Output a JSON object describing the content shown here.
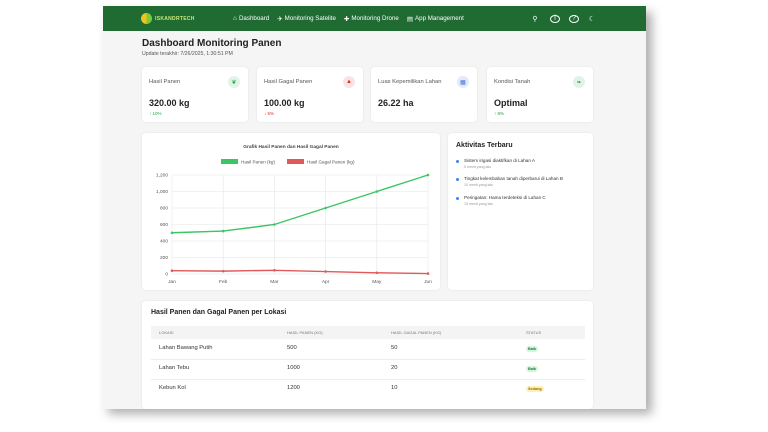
{
  "nav": {
    "logo_text": "ISKANDRTECH",
    "links": [
      {
        "label": "Dashboard",
        "icon": "home-icon"
      },
      {
        "label": "Monitoring Satelite",
        "icon": "satellite-icon"
      },
      {
        "label": "Monitoring Drone",
        "icon": "drone-icon"
      },
      {
        "label": "App Management",
        "icon": "database-icon"
      }
    ],
    "right_icons": [
      "location-icon",
      "info-icon",
      "help-icon",
      "moon-icon"
    ]
  },
  "page": {
    "title": "Dashboard Monitoring Panen",
    "updated": "Update terakhir: 7/26/2025, 1:30:51 PM"
  },
  "stats": [
    {
      "label": "Hasil Panen",
      "value": "320.00 kg",
      "delta": "↑ 10%",
      "trend": "up",
      "icon": "sprout-icon",
      "icon_color": "#22a348",
      "icon_bg": "#e1f3e6"
    },
    {
      "label": "Hasil Gagal Panen",
      "value": "100.00 kg",
      "delta": "↓ 5%",
      "trend": "down",
      "icon": "warning-icon",
      "icon_color": "#d93025",
      "icon_bg": "#fbe3e3"
    },
    {
      "label": "Luas Kepemilikan Lahan",
      "value": "26.22 ha",
      "delta": "",
      "trend": "none",
      "icon": "area-icon",
      "icon_color": "#3b6fd9",
      "icon_bg": "#e2eaf9"
    },
    {
      "label": "Kondisi Tanah",
      "value": "Optimal",
      "delta": "↑ 8%",
      "trend": "up",
      "icon": "leaf-icon",
      "icon_color": "#22a348",
      "icon_bg": "#e1f3e6"
    }
  ],
  "chart_data": {
    "type": "line",
    "title": "Grafik Hasil Panen dan Hasil Gagal Panen",
    "categories": [
      "Jan",
      "Feb",
      "Mar",
      "Apr",
      "May",
      "Jun"
    ],
    "series": [
      {
        "name": "Hasil Panen (kg)",
        "color": "#3cc564",
        "values": [
          500,
          520,
          600,
          800,
          1000,
          1200
        ]
      },
      {
        "name": "Hasil Gagal Panen (kg)",
        "color": "#e05a5a",
        "values": [
          40,
          35,
          45,
          30,
          15,
          5
        ]
      }
    ],
    "yticks": [
      "0",
      "200",
      "400",
      "600",
      "800",
      "1,000",
      "1,200"
    ],
    "ylim": [
      0,
      1200
    ],
    "legend": "top",
    "grid": true
  },
  "activity": {
    "title": "Aktivitas Terbaru",
    "items": [
      {
        "text": "Sistem irigasi diaktifkan di Lahan A",
        "time": "5 menit yang lalu"
      },
      {
        "text": "Tingkat kelembaban tanah diperbarui di Lahan B",
        "time": "10 menit yang lalu"
      },
      {
        "text": "Peringatan: Hama terdeteksi di Lahan C",
        "time": "15 menit yang lalu"
      }
    ]
  },
  "table": {
    "title": "Hasil Panen dan Gagal Panen per Lokasi",
    "headers": [
      "LOKASI",
      "HASIL PANEN (KG)",
      "HASIL GAGAL PANEN (KG)",
      "STATUS"
    ],
    "rows": [
      {
        "lokasi": "Lahan Bawang Putih",
        "panen": "500",
        "gagal": "50",
        "status": "Baik",
        "status_type": "green"
      },
      {
        "lokasi": "Lahan Tebu",
        "panen": "1000",
        "gagal": "20",
        "status": "Baik",
        "status_type": "green"
      },
      {
        "lokasi": "Kebun Kol",
        "panen": "1200",
        "gagal": "10",
        "status": "Sedang",
        "status_type": "yellow"
      }
    ]
  }
}
